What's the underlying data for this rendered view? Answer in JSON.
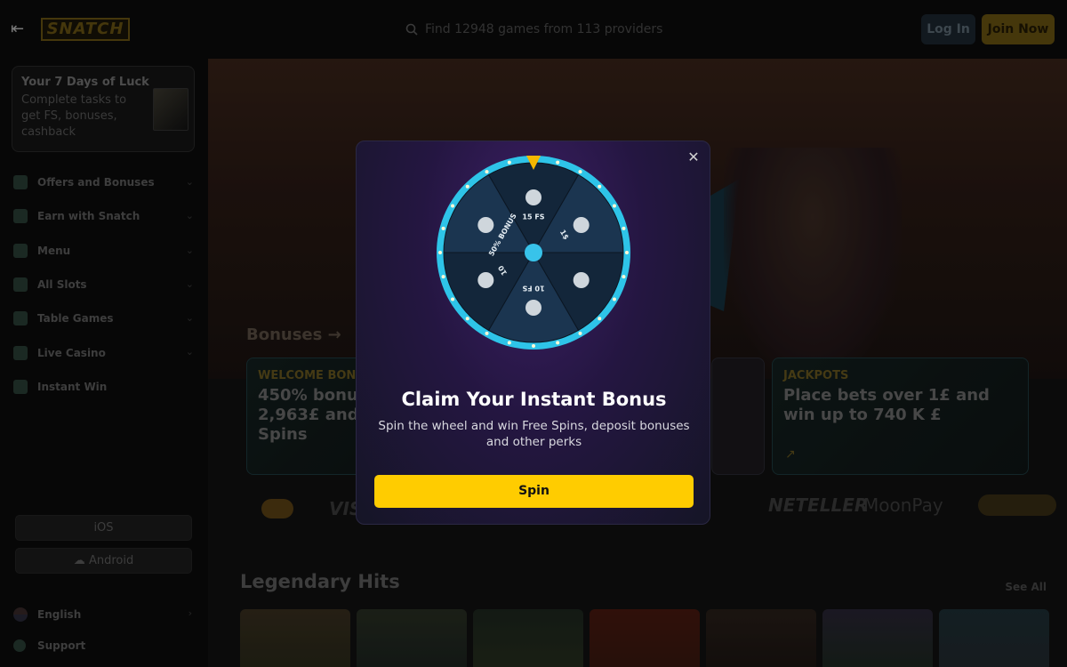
{
  "header": {
    "logo_text": "SNATCH",
    "search_placeholder": "Find 12948 games from 113 providers",
    "login_label": "Log In",
    "join_label": "Join Now"
  },
  "sidebar": {
    "promo": {
      "title": "Your 7 Days of Luck",
      "text": "Complete tasks to get FS, bonuses, cashback"
    },
    "items": [
      {
        "label": "Offers and Bonuses",
        "icon": "gift-icon",
        "expandable": true
      },
      {
        "label": "Earn with Snatch",
        "icon": "coins-icon",
        "expandable": true
      },
      {
        "label": "Menu",
        "icon": "menu-icon",
        "expandable": true
      },
      {
        "label": "All Slots",
        "icon": "slots-icon",
        "expandable": true
      },
      {
        "label": "Table Games",
        "icon": "table-games-icon",
        "expandable": true
      },
      {
        "label": "Live Casino",
        "icon": "live-casino-icon",
        "expandable": true
      },
      {
        "label": "Instant Win",
        "icon": "instant-win-icon",
        "expandable": false
      }
    ],
    "ios_label": "iOS",
    "android_label": "Android",
    "language_label": "English",
    "support_label": "Support"
  },
  "main": {
    "bonuses_title": "Bonuses →",
    "welcome": {
      "kicker": "WELCOME BONU",
      "title": "450% bonus 2,963£ and 3 Spins"
    },
    "jackpots": {
      "kicker": "JACKPOTS",
      "title": "Place bets over 1£ and win up to 740 K £"
    },
    "payments": [
      "VISA",
      "NETELLER",
      "MoonPay"
    ],
    "hits_title": "Legendary Hits",
    "see_all": "See All"
  },
  "modal": {
    "title": "Claim Your Instant Bonus",
    "subtitle": "Spin the wheel and win Free Spins, deposit bonuses and other perks",
    "spin_label": "Spin",
    "wheel": {
      "segments": [
        "15 FS",
        "1$",
        "",
        "10 FS",
        "10",
        "50% BONUS"
      ],
      "colors": {
        "rim": "#2ec4e8",
        "segment_a": "#13263a",
        "segment_b": "#1b3550",
        "hub": "#38c3ea",
        "pointer": "#f5b800"
      }
    }
  },
  "colors": {
    "accent": "#ffcc00",
    "background": "#111111"
  }
}
